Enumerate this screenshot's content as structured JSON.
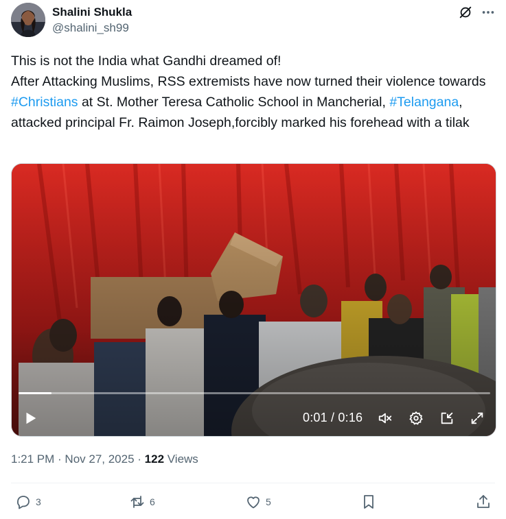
{
  "author": {
    "name": "Shalini Shukla",
    "handle": "@shalini_sh99"
  },
  "icons": {
    "grok": "grok-icon",
    "more": "more-icon",
    "play": "play-icon",
    "mute": "volume-muted-icon",
    "settings": "gear-icon",
    "pip": "picture-in-picture-icon",
    "fullscreen": "fullscreen-icon",
    "reply": "reply-icon",
    "retweet": "retweet-icon",
    "like": "heart-icon",
    "bookmark": "bookmark-icon",
    "share": "share-icon"
  },
  "tweet": {
    "line1": "This is not the India what Gandhi dreamed of!",
    "line2_a": "After Attacking Muslims, RSS extremists have now turned their violence towards ",
    "hashtag1": "#Christians",
    "line2_b": " at St. Mother Teresa Catholic School in Mancherial, ",
    "hashtag2": "#Telangana",
    "line2_c": ", attacked principal Fr. Raimon Joseph,forcibly marked his forehead with a tilak"
  },
  "video": {
    "time_display": "0:01 / 0:16",
    "progress_fraction": 0.07
  },
  "meta": {
    "time": "1:21 PM",
    "sep1": " · ",
    "date": "Nov 27, 2025",
    "sep2": " · ",
    "views_count": "122",
    "views_label": " Views"
  },
  "actions": {
    "reply_count": "3",
    "retweet_count": "6",
    "like_count": "5"
  },
  "colors": {
    "link": "#1d9bf0",
    "secondary_text": "#536471",
    "primary_text": "#0f1419"
  }
}
